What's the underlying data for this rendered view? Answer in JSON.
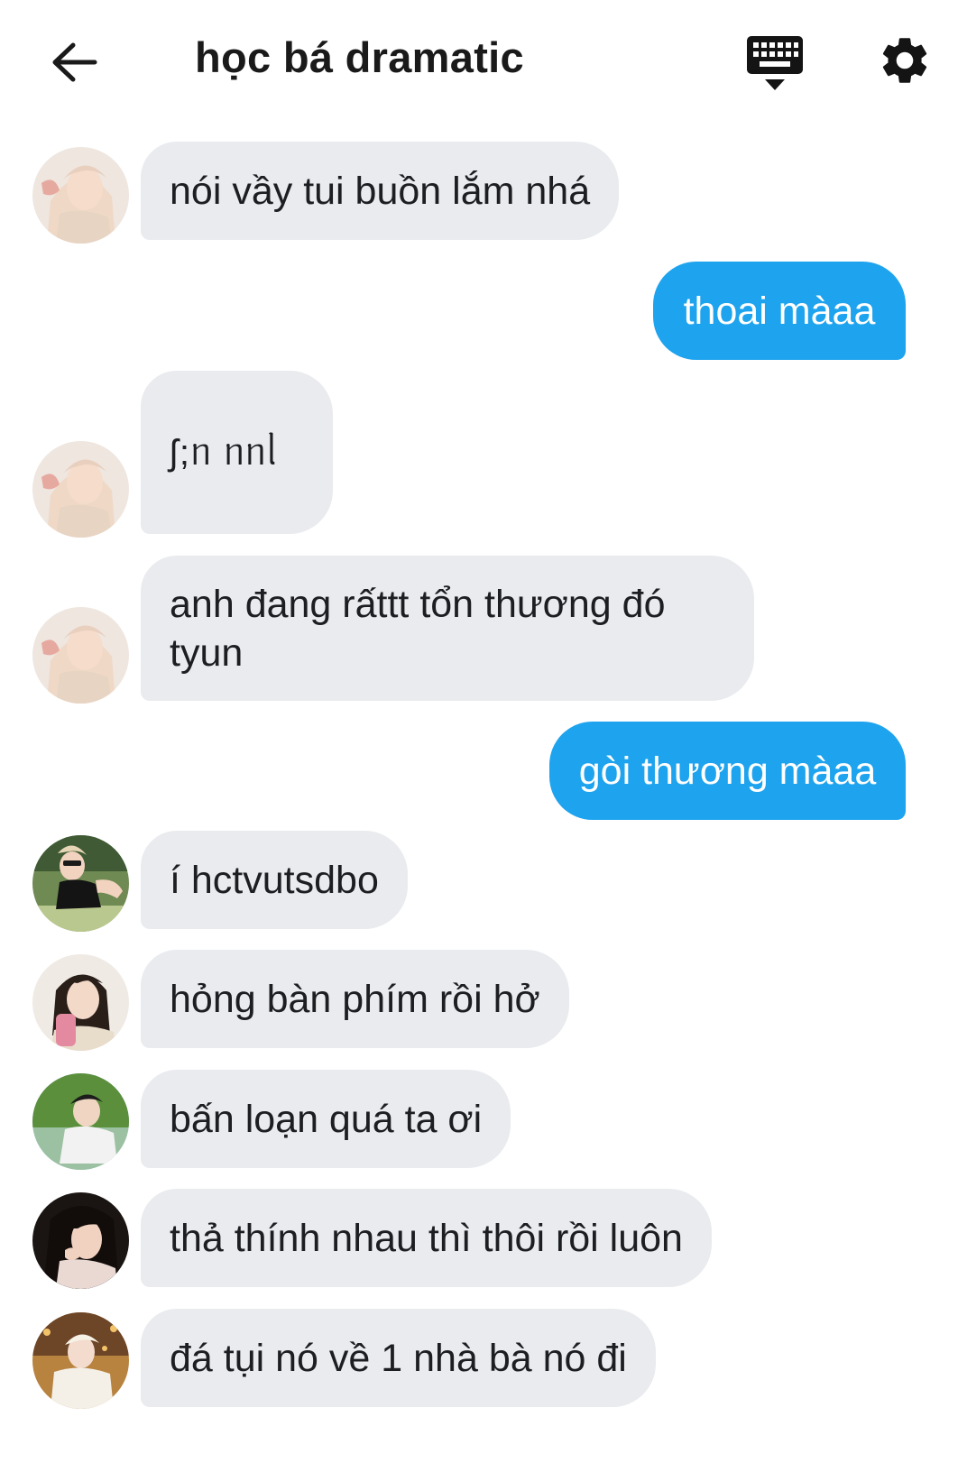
{
  "header": {
    "title": "học bá dramatic"
  },
  "icons": {
    "back": "arrow-left-icon",
    "keyboard": "keyboard-icon",
    "settings": "gear-icon"
  },
  "colors": {
    "outgoing_bubble": "#1ea3ee",
    "incoming_bubble": "#e9ebee",
    "text": "#1c1e21"
  },
  "messages": [
    {
      "direction": "incoming",
      "text": "nói vầy tui buồn lắm nhá"
    },
    {
      "direction": "outgoing",
      "text": "thoai màaa"
    },
    {
      "direction": "incoming",
      "text": "ʃ;ᥒ ᥒᥒᥣ"
    },
    {
      "direction": "incoming",
      "text": "anh đang rấttt tổn thương đó tyun"
    },
    {
      "direction": "outgoing",
      "text": "gòi thương màaa"
    },
    {
      "direction": "incoming",
      "text": "í hctvutsdbo"
    },
    {
      "direction": "incoming",
      "text": "hỏng bàn phím rồi hở"
    },
    {
      "direction": "incoming",
      "text": "bấn loạn quá ta ơi"
    },
    {
      "direction": "incoming",
      "text": "thả thính nhau thì thôi rồi luôn"
    },
    {
      "direction": "incoming",
      "text": "đá tụi nó về 1 nhà bà nó đi"
    }
  ]
}
